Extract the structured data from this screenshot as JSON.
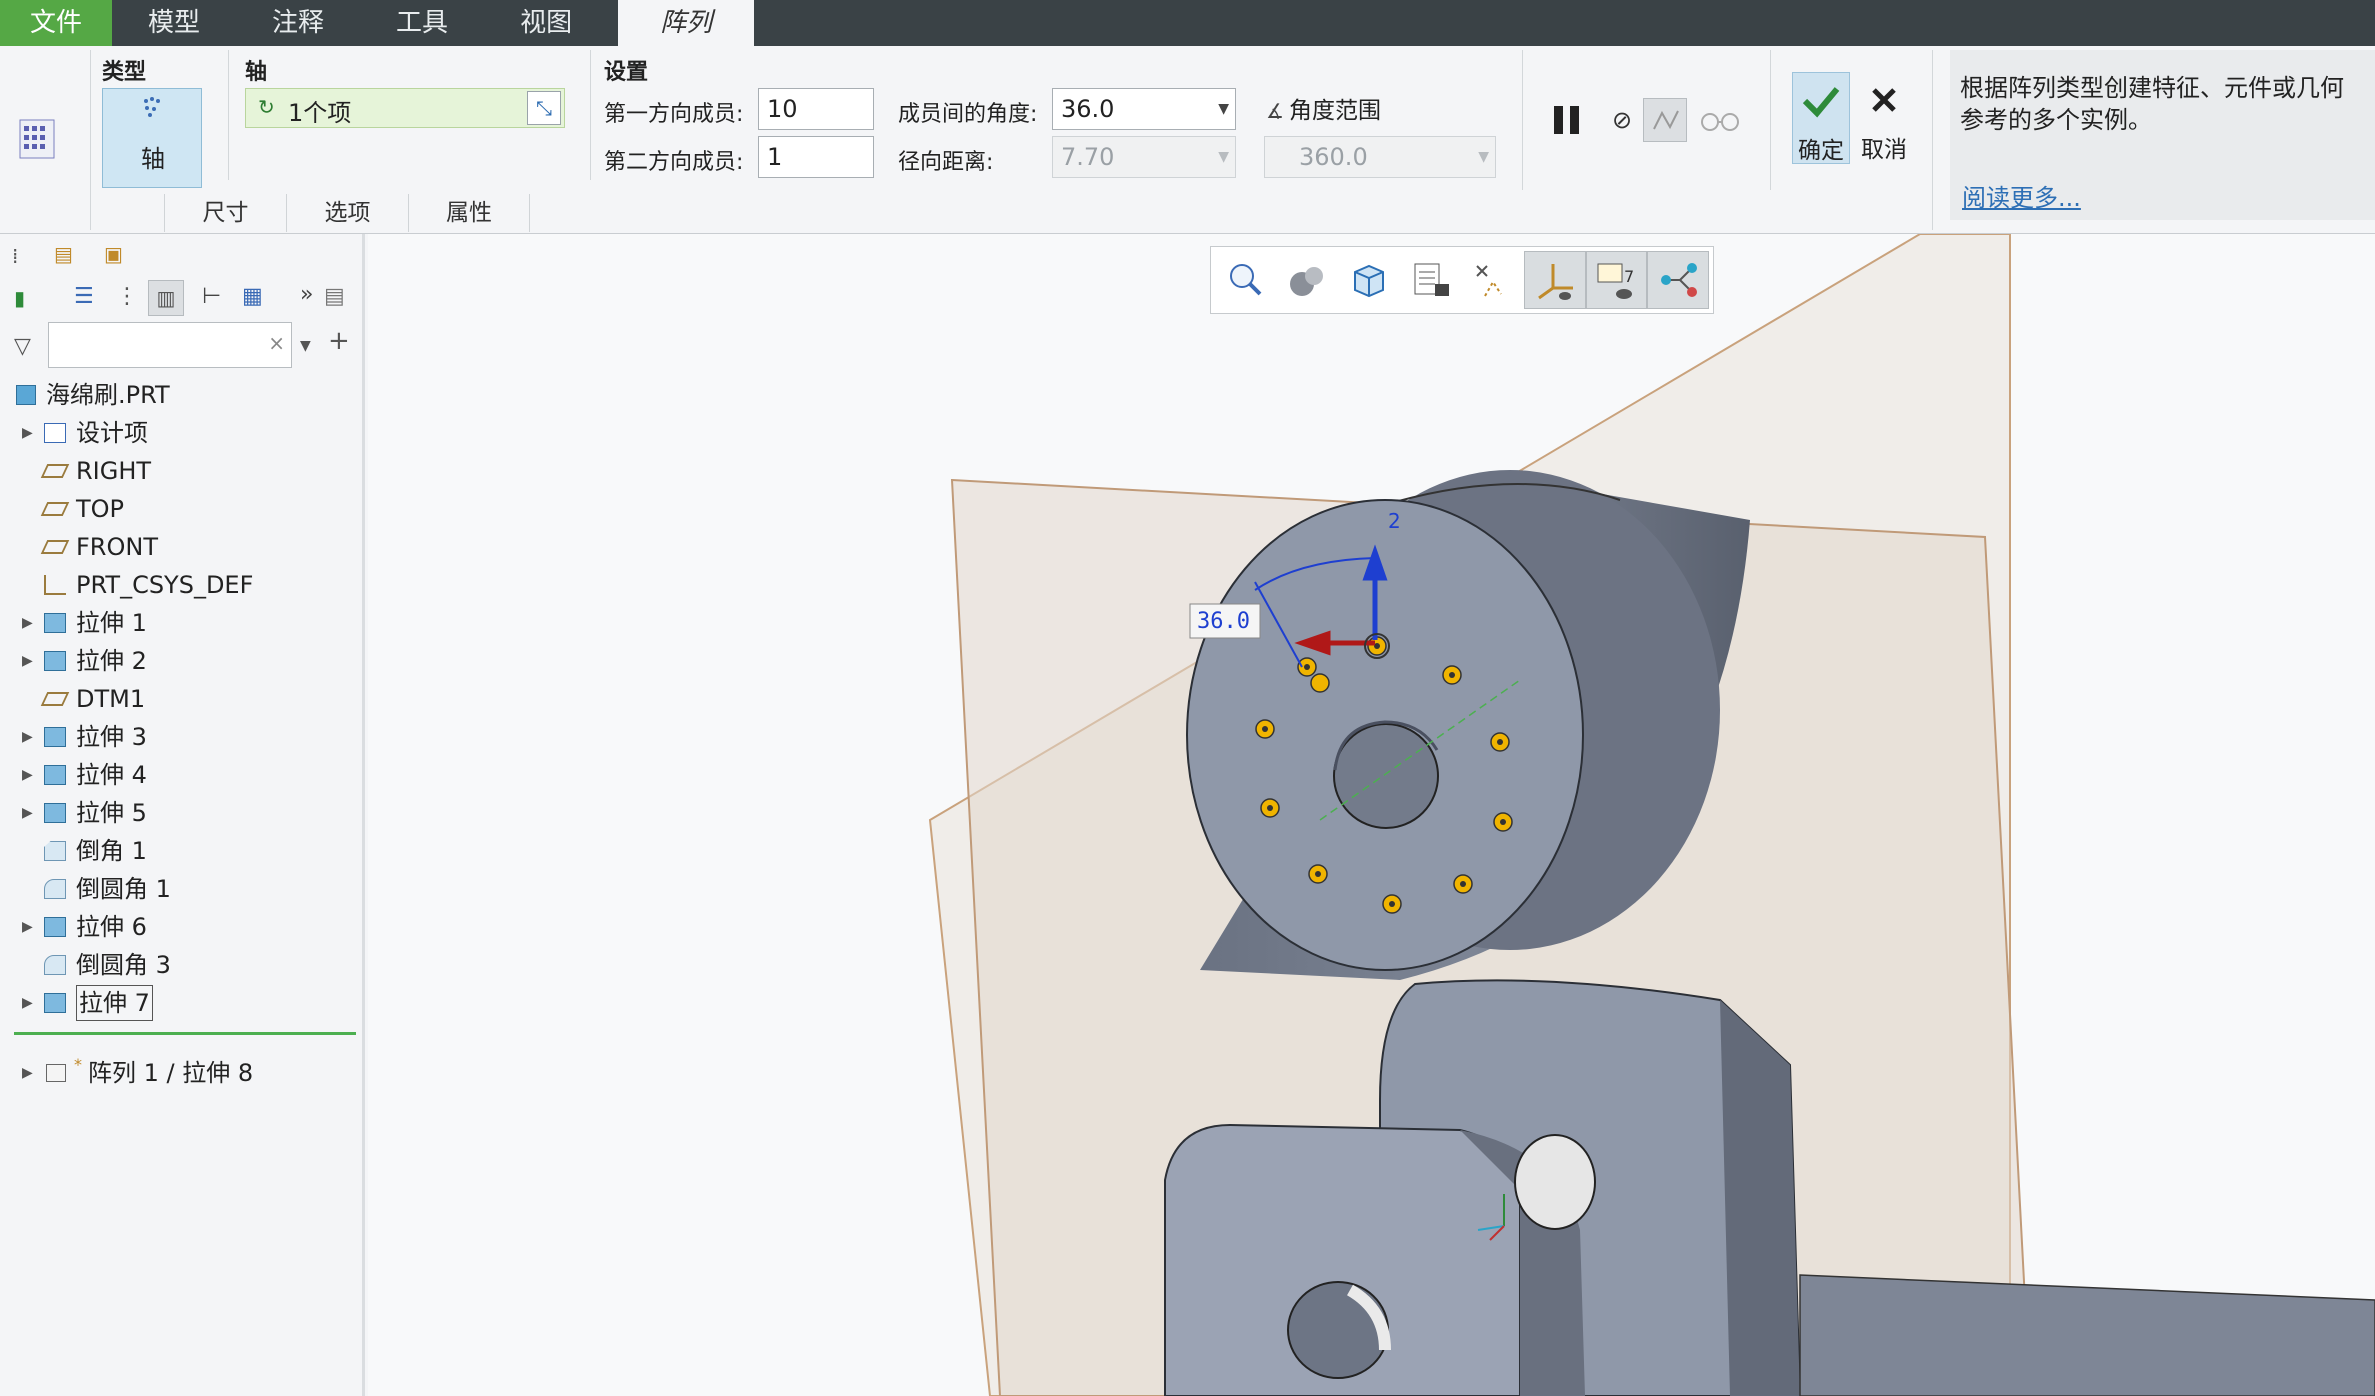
{
  "menubar": {
    "items": [
      "文件",
      "模型",
      "注释",
      "工具",
      "视图"
    ],
    "active_tab": "阵列"
  },
  "ribbon": {
    "type_label": "类型",
    "type_value": "轴",
    "axis_label": "轴",
    "axis_value": "1个项",
    "settings_label": "设置",
    "first_dir_label": "第一方向成员:",
    "first_dir_value": "10",
    "second_dir_label": "第二方向成员:",
    "second_dir_value": "1",
    "angle_label": "成员间的角度:",
    "angle_value": "36.0",
    "radial_label": "径向距离:",
    "radial_value": "7.70",
    "angle_range_label": "角度范围",
    "angle_range_value": "360.0",
    "ok_label": "确定",
    "cancel_label": "取消",
    "subtabs": [
      "尺寸",
      "选项",
      "属性"
    ]
  },
  "help": {
    "text": "根据阵列类型创建特征、元件或几何参考的多个实例。",
    "read_more": "阅读更多..."
  },
  "tree": {
    "root": "海绵刷.PRT",
    "items": [
      {
        "label": "设计项",
        "icon": "design-items-icon",
        "expandable": true
      },
      {
        "label": "RIGHT",
        "icon": "datum-plane-icon",
        "expandable": false
      },
      {
        "label": "TOP",
        "icon": "datum-plane-icon",
        "expandable": false
      },
      {
        "label": "FRONT",
        "icon": "datum-plane-icon",
        "expandable": false
      },
      {
        "label": "PRT_CSYS_DEF",
        "icon": "csys-icon",
        "expandable": false
      },
      {
        "label": "拉伸 1",
        "icon": "extrude-icon",
        "expandable": true
      },
      {
        "label": "拉伸 2",
        "icon": "extrude-icon",
        "expandable": true
      },
      {
        "label": "DTM1",
        "icon": "datum-plane-icon",
        "expandable": false
      },
      {
        "label": "拉伸 3",
        "icon": "extrude-icon",
        "expandable": true
      },
      {
        "label": "拉伸 4",
        "icon": "extrude-icon",
        "expandable": true
      },
      {
        "label": "拉伸 5",
        "icon": "extrude-icon",
        "expandable": true
      },
      {
        "label": "倒角 1",
        "icon": "chamfer-icon",
        "expandable": false
      },
      {
        "label": "倒圆角 1",
        "icon": "round-icon",
        "expandable": false
      },
      {
        "label": "拉伸 6",
        "icon": "extrude-icon",
        "expandable": true
      },
      {
        "label": "倒圆角 3",
        "icon": "round-icon",
        "expandable": false
      },
      {
        "label": "拉伸 7",
        "icon": "extrude-icon",
        "expandable": true
      }
    ],
    "pattern_item": "阵列 1 / 拉伸 8"
  },
  "viewport": {
    "dimension_label": "36.0",
    "direction_label": "2"
  },
  "colors": {
    "menubar_bg": "#3a4246",
    "file_tab": "#55a845",
    "insert_line": "#4caf50",
    "selection_point": "#f0b400",
    "link": "#2d6fb5"
  }
}
